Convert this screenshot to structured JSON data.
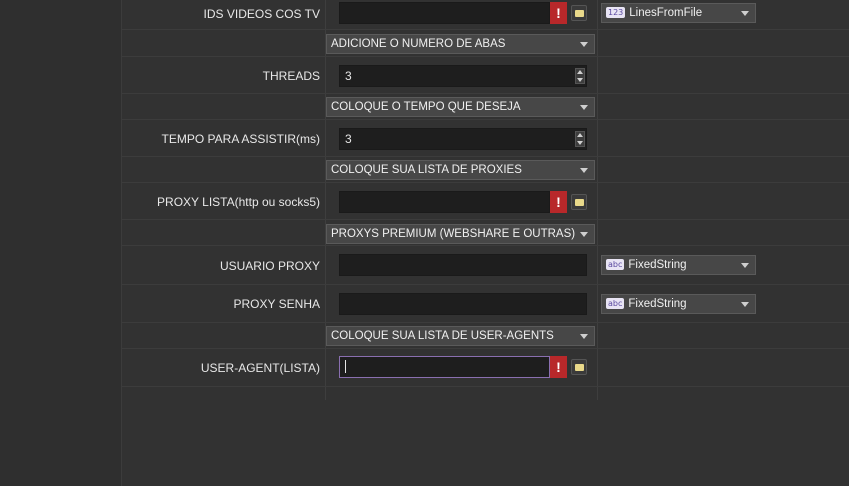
{
  "rows": {
    "ids_videos": {
      "label": "IDS VIDEOS COS TV",
      "value": "",
      "type_badge": "123",
      "type_value": "LinesFromFile"
    },
    "tabs_section": {
      "label": "ADICIONE O NUMERO DE ABAS"
    },
    "threads": {
      "label": "THREADS",
      "value": "3"
    },
    "time_section": {
      "label": "COLOQUE O TEMPO QUE DESEJA"
    },
    "watch_time": {
      "label": "TEMPO PARA ASSISTIR(ms)",
      "value": "3"
    },
    "proxy_list_section": {
      "label": "COLOQUE SUA LISTA DE PROXIES"
    },
    "proxy_list": {
      "label": "PROXY LISTA(http ou socks5)",
      "value": ""
    },
    "premium_section": {
      "label": "PROXYS PREMIUM (WEBSHARE E OUTRAS)"
    },
    "proxy_user": {
      "label": "USUARIO PROXY",
      "value": "",
      "type_badge": "abc",
      "type_value": "FixedString"
    },
    "proxy_password": {
      "label": "PROXY SENHA",
      "value": "",
      "type_badge": "abc",
      "type_value": "FixedString"
    },
    "ua_section": {
      "label": "COLOQUE SUA LISTA DE USER-AGENTS"
    },
    "user_agent": {
      "label": "USER-AGENT(LISTA)",
      "value": ""
    }
  },
  "icons": {
    "warning": "!",
    "folder": "folder-icon"
  },
  "colors": {
    "background": "#323232",
    "input_bg": "#1e1e1e",
    "warning_red": "#b8282a",
    "focus_border": "#8a6fb0"
  }
}
